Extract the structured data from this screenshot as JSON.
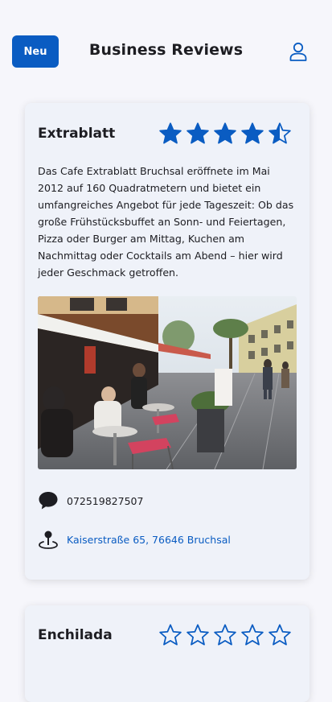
{
  "header": {
    "new_label": "Neu",
    "title": "Business Reviews",
    "user_icon": "user-icon"
  },
  "colors": {
    "accent": "#0a5cc2",
    "background": "#f6f6fb",
    "card": "#eff2f9"
  },
  "businesses": [
    {
      "name": "Extrablatt",
      "rating": 4.5,
      "rating_max": 5,
      "description": "Das Cafe Extrablatt Bruchsal eröffnete im Mai 2012 auf 160 Quadratmetern und bietet ein umfangreiches Angebot für jede Tageszeit: Ob das große Frühstücksbuffet an Sonn- und Feiertagen, Pizza oder Burger am Mittag, Kuchen am Nachmittag oder Cocktails am Abend – hier wird jeder Geschmack getroffen.",
      "phone": "072519827507",
      "address": "Kaiserstraße 65, 76646 Bruchsal",
      "phone_icon": "speech-bubble-icon",
      "address_icon": "map-pin-icon"
    },
    {
      "name": "Enchilada",
      "rating": 0,
      "rating_max": 5
    }
  ]
}
